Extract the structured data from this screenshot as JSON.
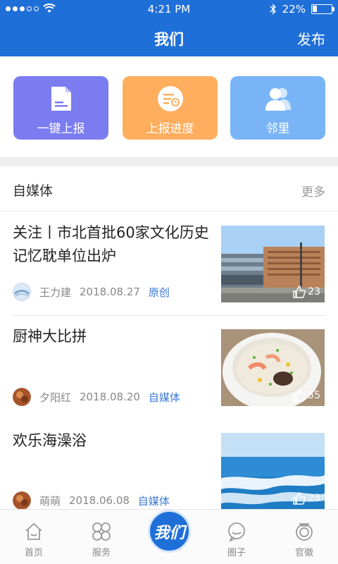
{
  "status_bar": {
    "time": "4:21 PM",
    "battery": "22%",
    "battery_level": 0.22
  },
  "header": {
    "title": "我们",
    "publish": "发布"
  },
  "actions": [
    {
      "label": "一键上报",
      "icon": "document-icon",
      "color": "#7b7cf0"
    },
    {
      "label": "上报进度",
      "icon": "progress-list-icon",
      "color": "#ffae5e"
    },
    {
      "label": "邻里",
      "icon": "neighbors-icon",
      "color": "#79b4f7"
    }
  ],
  "section": {
    "title": "自媒体",
    "more": "更多"
  },
  "news": [
    {
      "title": "关注丨市北首批60家文化历史记忆耽单位出炉",
      "author": "王力建",
      "date": "2018.08.27",
      "tag": "原创",
      "likes": "23",
      "image": "building-photo"
    },
    {
      "title": "厨神大比拼",
      "author": "夕阳红",
      "date": "2018.08.20",
      "tag": "自媒体",
      "likes": "55",
      "image": "congee-photo"
    },
    {
      "title": "欢乐海澡浴",
      "author": "萌萌",
      "date": "2018.06.08",
      "tag": "自媒体",
      "likes": "23",
      "image": "sea-photo"
    }
  ],
  "tabs": {
    "home": "首页",
    "services": "服务",
    "center": "我们",
    "circle": "圈子",
    "badge": "官徽"
  },
  "colors": {
    "primary": "#1f6fd8",
    "tag": "#3b78d8"
  }
}
